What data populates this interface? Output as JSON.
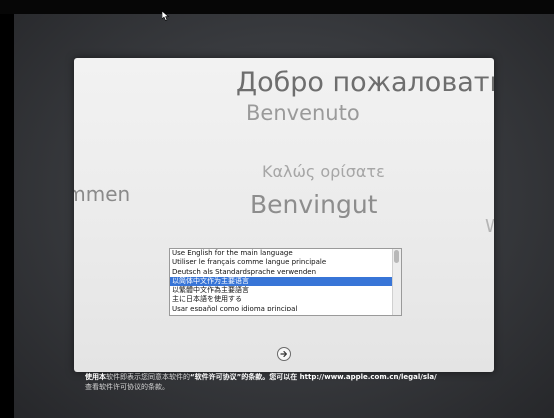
{
  "greetings": {
    "russian": "Добро пожаловать!",
    "italian": "Benvenuto",
    "greek": "Καλώς ορίσατε",
    "german_partial": "ommen",
    "catalan": "Benvingut",
    "partial_w": "W"
  },
  "language_list": {
    "items": [
      "Use English for the main language",
      "Utiliser le français comme langue principale",
      "Deutsch als Standardsprache verwenden",
      "以简体中文作为主要语言",
      "以繁體中文作為主要語言",
      "主に日本語を使用する",
      "Usar español como idioma principal"
    ],
    "selected_index": 3
  },
  "continue_button": {
    "icon": "right-arrow-circle-icon"
  },
  "license": {
    "line1_part1": "使用本",
    "line1_part2": "软件即表示您同意本软件的",
    "line1_part3": "“软件许可协议”",
    "line1_part4": "的条款。您可以在 http://www.apple.com.cn/legal/sla/",
    "line2": "查看软件许可协议的条款。"
  },
  "colors": {
    "selection": "#3875d7",
    "panel": "#f0f0f0",
    "background": "#3a3c40"
  }
}
